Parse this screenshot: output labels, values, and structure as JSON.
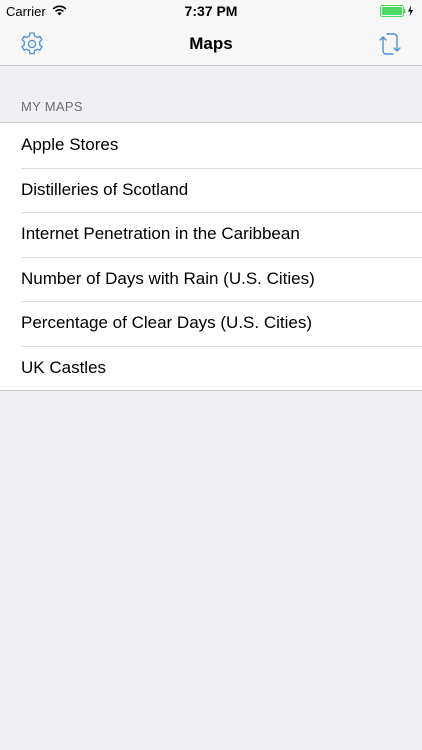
{
  "status_bar": {
    "carrier": "Carrier",
    "time": "7:37 PM",
    "battery_color": "#4cd964"
  },
  "nav": {
    "title": "Maps",
    "left_icon": "gear-icon",
    "right_icon": "sync-icon",
    "tint_color": "#4a90d9"
  },
  "section": {
    "header": "MY MAPS"
  },
  "maps": [
    {
      "label": "Apple Stores"
    },
    {
      "label": "Distilleries of Scotland"
    },
    {
      "label": "Internet Penetration in the Caribbean"
    },
    {
      "label": "Number of Days with Rain (U.S. Cities)"
    },
    {
      "label": "Percentage of Clear Days (U.S. Cities)"
    },
    {
      "label": "UK Castles"
    }
  ]
}
